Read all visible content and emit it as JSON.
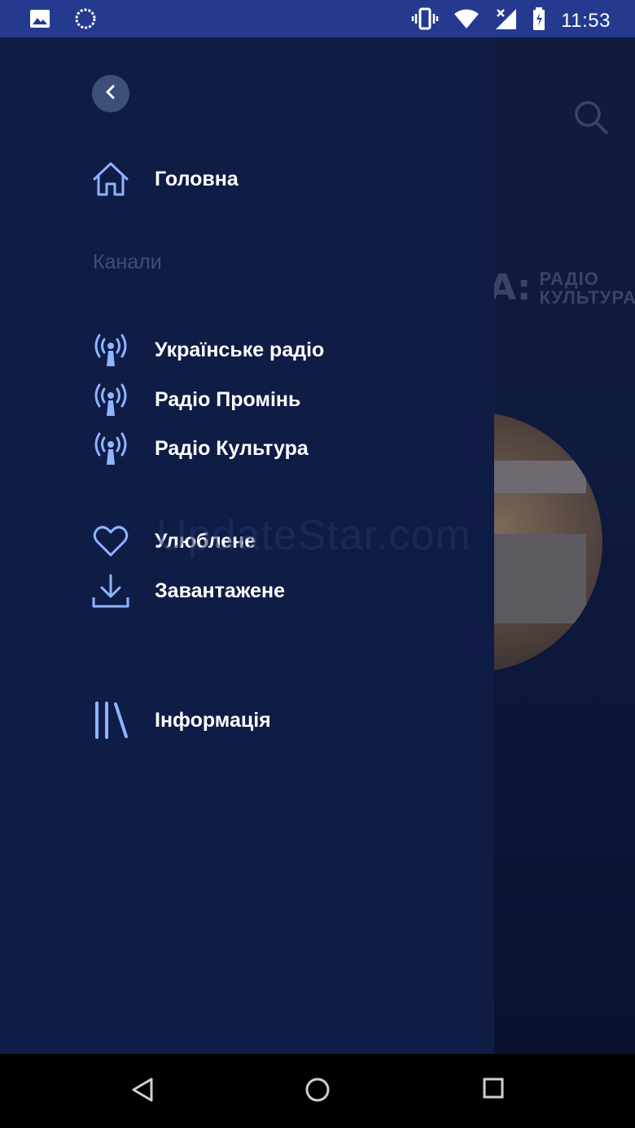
{
  "status_bar": {
    "left_icons": [
      "image-icon",
      "sync-icon"
    ],
    "right_icons": [
      "vibrate-icon",
      "wifi-icon",
      "signal-icon",
      "battery-icon"
    ],
    "time": "11:53"
  },
  "background_app": {
    "logo_mark": "A:",
    "logo_line1": "РАДІО",
    "logo_line2": "КУЛЬТУРА"
  },
  "drawer": {
    "back_icon": "chevron-left-icon",
    "home": {
      "label": "Головна",
      "icon": "home-icon"
    },
    "channels_title": "Канали",
    "channels": [
      {
        "label": "Українське радіо",
        "icon": "radio-tower-icon"
      },
      {
        "label": "Радіо Промінь",
        "icon": "radio-tower-icon"
      },
      {
        "label": "Радіо Культура",
        "icon": "radio-tower-icon"
      }
    ],
    "favorites": {
      "label": "Улюблене",
      "icon": "heart-icon"
    },
    "downloads": {
      "label": "Завантажене",
      "icon": "download-icon"
    },
    "info": {
      "label": "Інформація",
      "icon": "library-icon"
    }
  },
  "watermark": "UpdateStar.com",
  "nav_bar": [
    "back-triangle-icon",
    "home-circle-icon",
    "recents-square-icon"
  ],
  "colors": {
    "status_bar": "#253a8e",
    "drawer_bg": "#0e1c46",
    "accent_icon": "#8fb4ff",
    "section_title": "#3f4e7e",
    "text": "#ffffff"
  }
}
